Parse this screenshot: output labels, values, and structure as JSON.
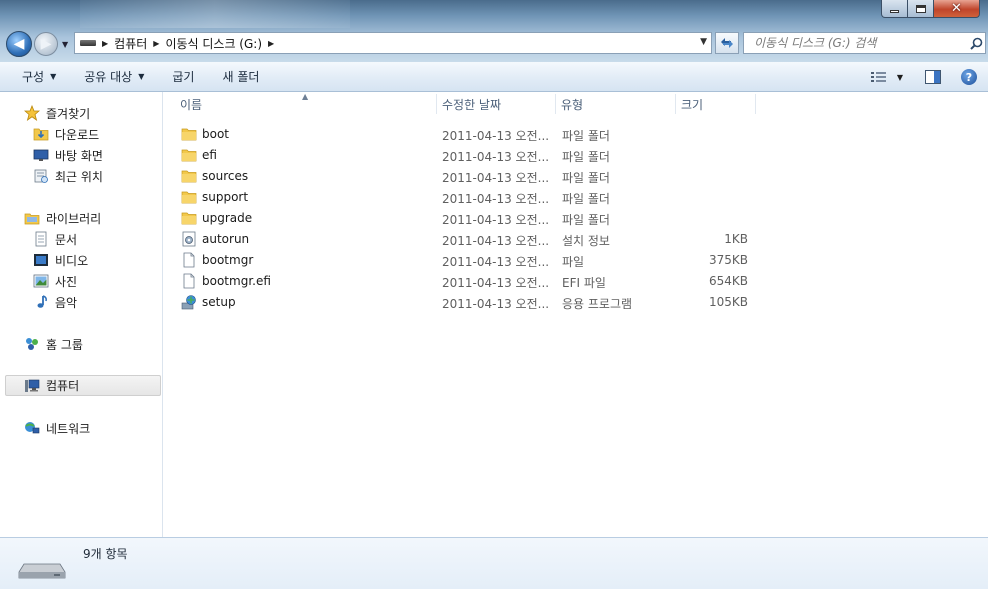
{
  "window": {
    "minimize_glyph": "",
    "close_glyph": "✕"
  },
  "nav_buttons": {
    "back": "◀",
    "forward": "▶"
  },
  "address": {
    "crumbs": [
      "컴퓨터",
      "이동식 디스크 (G:)"
    ]
  },
  "search": {
    "placeholder": "이동식 디스크 (G:) 검색"
  },
  "toolbar": {
    "organize": "구성",
    "share_with": "공유 대상",
    "burn": "굽기",
    "new_folder": "새 폴더"
  },
  "sidebar": {
    "favorites": {
      "label": "즐겨찾기",
      "items": [
        "다운로드",
        "바탕 화면",
        "최근 위치"
      ]
    },
    "libraries": {
      "label": "라이브러리",
      "items": [
        "문서",
        "비디오",
        "사진",
        "음악"
      ]
    },
    "homegroup": "홈 그룹",
    "computer": "컴퓨터",
    "network": "네트워크"
  },
  "columns": {
    "name": "이름",
    "date_modified": "수정한 날짜",
    "type": "유형",
    "size": "크기"
  },
  "files": [
    {
      "name": "boot",
      "date": "2011-04-13 오전...",
      "type": "파일 폴더",
      "size": "",
      "icon": "folder-icon"
    },
    {
      "name": "efi",
      "date": "2011-04-13 오전...",
      "type": "파일 폴더",
      "size": "",
      "icon": "folder-icon"
    },
    {
      "name": "sources",
      "date": "2011-04-13 오전...",
      "type": "파일 폴더",
      "size": "",
      "icon": "folder-icon"
    },
    {
      "name": "support",
      "date": "2011-04-13 오전...",
      "type": "파일 폴더",
      "size": "",
      "icon": "folder-icon"
    },
    {
      "name": "upgrade",
      "date": "2011-04-13 오전...",
      "type": "파일 폴더",
      "size": "",
      "icon": "folder-icon"
    },
    {
      "name": "autorun",
      "date": "2011-04-13 오전...",
      "type": "설치 정보",
      "size": "1KB",
      "icon": "settings-file-icon"
    },
    {
      "name": "bootmgr",
      "date": "2011-04-13 오전...",
      "type": "파일",
      "size": "375KB",
      "icon": "blank-file-icon"
    },
    {
      "name": "bootmgr.efi",
      "date": "2011-04-13 오전...",
      "type": "EFI 파일",
      "size": "654KB",
      "icon": "blank-file-icon"
    },
    {
      "name": "setup",
      "date": "2011-04-13 오전...",
      "type": "응용 프로그램",
      "size": "105KB",
      "icon": "setup-app-icon"
    }
  ],
  "status": {
    "item_count": "9개 항목"
  },
  "colors": {
    "folder": "#f2c84b",
    "accent": "#2f6fb7",
    "header_text": "#4c607a"
  }
}
